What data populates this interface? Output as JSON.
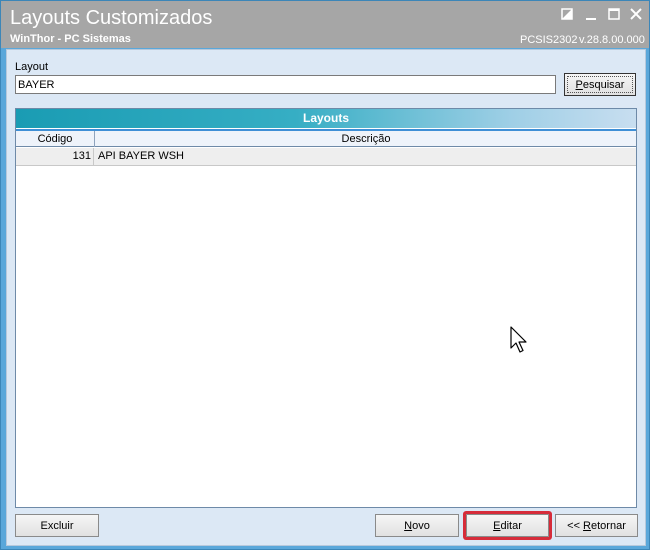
{
  "window": {
    "title": "Layouts Customizados",
    "subtitle": "WinThor - PC Sistemas",
    "module_code": "PCSIS2302",
    "version": "v.28.8.00.000",
    "controls": [
      "restore-icon",
      "minimize-icon",
      "maximize-icon",
      "close-icon"
    ]
  },
  "filter": {
    "label": "Layout",
    "value": "BAYER",
    "search_label_accel": "P",
    "search_label_rest": "esquisar"
  },
  "grid": {
    "caption": "Layouts",
    "columns": [
      "Código",
      "Descrição"
    ],
    "rows": [
      {
        "codigo": "131",
        "descricao": "API BAYER WSH"
      }
    ]
  },
  "actions": {
    "excluir": "Excluir",
    "novo_accel": "N",
    "novo_rest": "ovo",
    "editar_accel": "E",
    "editar_rest": "ditar",
    "retornar_prefix": "<< ",
    "retornar_accel": "R",
    "retornar_rest": "etornar"
  },
  "colors": {
    "titlebar": "#a6a6a6",
    "client": "#dce8f5",
    "caption_bar": "#1a9cb3",
    "highlight": "#d62c3a"
  }
}
